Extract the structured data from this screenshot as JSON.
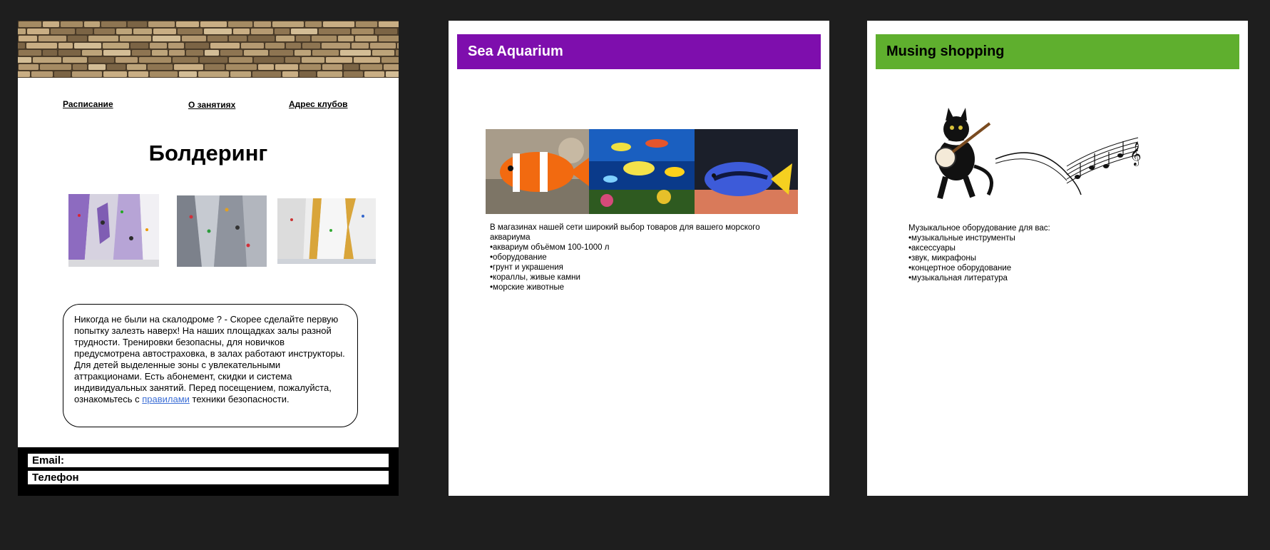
{
  "bouldering": {
    "nav": [
      "Расписание",
      "О занятиях",
      "Адрес клубов"
    ],
    "title": "Болдеринг",
    "text_before_link": "Никогда не были на скалодроме ? - Скорее сделайте первую попытку залезть наверх! На наших площадках залы разной трудности. Тренировки безопасны, для новичков предусмотрена автостраховка, в залах работают инструкторы. Для детей выделенные зоны с увлекательными аттракционами. Есть абонемент, скидки и система индивидуальных занятий. Перед посещением, пожалуйста, ознакомьтесь с ",
    "link_text": "правилами",
    "text_after_link": " техники безопасности.",
    "email_label": "Email:",
    "phone_label": "Телефон"
  },
  "aquarium": {
    "banner": "Sea Aquarium",
    "banner_color": "#7e0ead",
    "intro": "В магазинах нашей сети широкий выбор товаров для вашего морского аквариума",
    "items": [
      "аквариум объёмом 100-1000 л",
      "оборудование",
      "грунт и украшения",
      "кораллы, живые камни",
      "морские животные"
    ]
  },
  "music": {
    "banner": "Musing shopping",
    "banner_color": "#5faf2e",
    "intro": "Музыкальное оборудование для вас:",
    "items": [
      "музыкальные инструменты",
      "аксессуары",
      "звук, микрафоны",
      "концертное оборудование",
      "музыкальная литература"
    ]
  }
}
